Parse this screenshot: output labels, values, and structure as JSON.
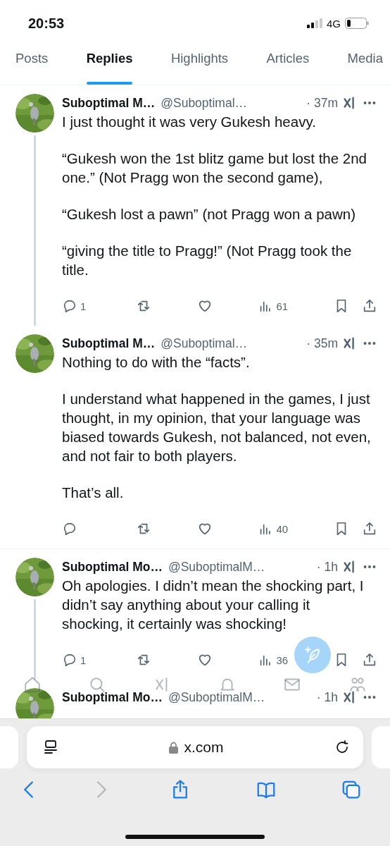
{
  "status_bar": {
    "time": "20:53",
    "network": "4G"
  },
  "tabs": [
    {
      "label": "Posts",
      "selected": false
    },
    {
      "label": "Replies",
      "selected": true
    },
    {
      "label": "Highlights",
      "selected": false
    },
    {
      "label": "Articles",
      "selected": false
    },
    {
      "label": "Media",
      "selected": false
    }
  ],
  "posts": [
    {
      "name": "Suboptimal M…",
      "handle": "@Suboptimal…",
      "time": "· 37m",
      "thread_line": true,
      "paragraphs": [
        "I just thought it was very Gukesh heavy.",
        "“Gukesh won the 1st blitz game but lost the 2nd one.” (Not Pragg won the second game),",
        "“Gukesh lost a pawn” (not Pragg won a pawn)",
        "“giving the title to Pragg!” (Not Pragg took the title."
      ],
      "actions": {
        "replies": "1",
        "views": "61"
      }
    },
    {
      "name": "Suboptimal M…",
      "handle": "@Suboptimal…",
      "time": "· 35m",
      "thread_line": false,
      "paragraphs": [
        "Nothing to do with the “facts”.",
        "I understand what happened in the games, I just thought, in my opinion, that your language was biased towards Gukesh, not balanced, not even, and not fair to both players.",
        "That’s all."
      ],
      "actions": {
        "views": "40"
      }
    },
    {
      "name": "Suboptimal Mo…",
      "handle": "@SuboptimalM…",
      "time": "· 1h",
      "thread_line": true,
      "paragraphs": [
        "Oh apologies. I didn’t mean the shocking part, I didn’t say anything about your calling it shocking, it certainly was shocking!"
      ],
      "actions": {
        "replies": "1",
        "views": "36"
      }
    },
    {
      "name": "Suboptimal Mo…",
      "handle": "@SuboptimalM…",
      "time": "· 1h",
      "thread_line": false
    }
  ],
  "browser": {
    "url": "x.com",
    "forward_disabled": true
  }
}
